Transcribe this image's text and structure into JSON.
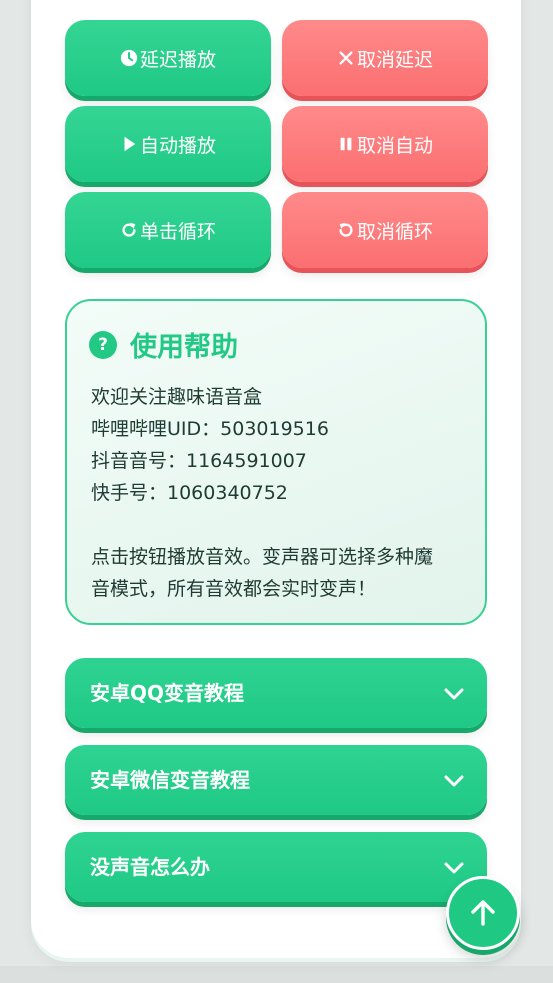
{
  "buttons": {
    "delay_play": "延迟播放",
    "cancel_delay": "取消延迟",
    "auto_play": "自动播放",
    "cancel_auto": "取消自动",
    "single_loop": "单击循环",
    "cancel_loop": "取消循环"
  },
  "help": {
    "icon": "?",
    "title": "使用帮助",
    "line1": "欢迎关注趣味语音盒",
    "line2": "哔哩哔哩UID：503019516",
    "line3": "抖音音号：1164591007",
    "line4": "快手号：1060340752",
    "line5": "点击按钮播放音效。变声器可选择多种魔",
    "line6": "音模式，所有音效都会实时变声！"
  },
  "accordion": {
    "item1": "安卓QQ变音教程",
    "item2": "安卓微信变音教程",
    "item3": "没声音怎么办"
  },
  "colors": {
    "primary_green": "#22c985",
    "cancel_red": "#fb6f71"
  }
}
